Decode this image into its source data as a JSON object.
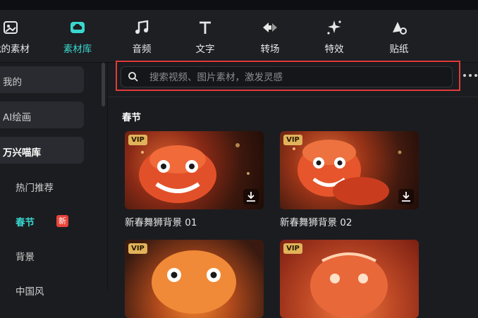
{
  "toolbar": {
    "items": [
      {
        "label": "我的素材",
        "icon": "media-icon",
        "active": false
      },
      {
        "label": "素材库",
        "icon": "cloud-library-icon",
        "active": true
      },
      {
        "label": "音频",
        "icon": "music-note-icon",
        "active": false
      },
      {
        "label": "文字",
        "icon": "text-icon",
        "active": false
      },
      {
        "label": "转场",
        "icon": "transition-icon",
        "active": false
      },
      {
        "label": "特效",
        "icon": "sparkle-effect-icon",
        "active": false
      },
      {
        "label": "贴纸",
        "icon": "sticker-icon",
        "active": false
      }
    ]
  },
  "sidebar": {
    "items": [
      {
        "label": "我的"
      },
      {
        "label": "AI绘画"
      },
      {
        "label": "万兴喵库"
      }
    ],
    "sub_items": [
      {
        "label": "热门推荐"
      },
      {
        "label": "春节",
        "badge": "新"
      },
      {
        "label": "背景"
      },
      {
        "label": "中国风"
      }
    ]
  },
  "search": {
    "placeholder": "搜索视频、图片素材，激发灵感"
  },
  "section": {
    "title": "春节"
  },
  "cards": [
    {
      "title": "新春舞狮背景 01",
      "badge": "VIP"
    },
    {
      "title": "新春舞狮背景 02",
      "badge": "VIP"
    },
    {
      "title": "",
      "badge": "VIP"
    },
    {
      "title": "",
      "badge": "VIP"
    }
  ],
  "colors": {
    "accent": "#39d8cf",
    "highlight": "#e03b3b",
    "vip": "#e1b35a"
  }
}
